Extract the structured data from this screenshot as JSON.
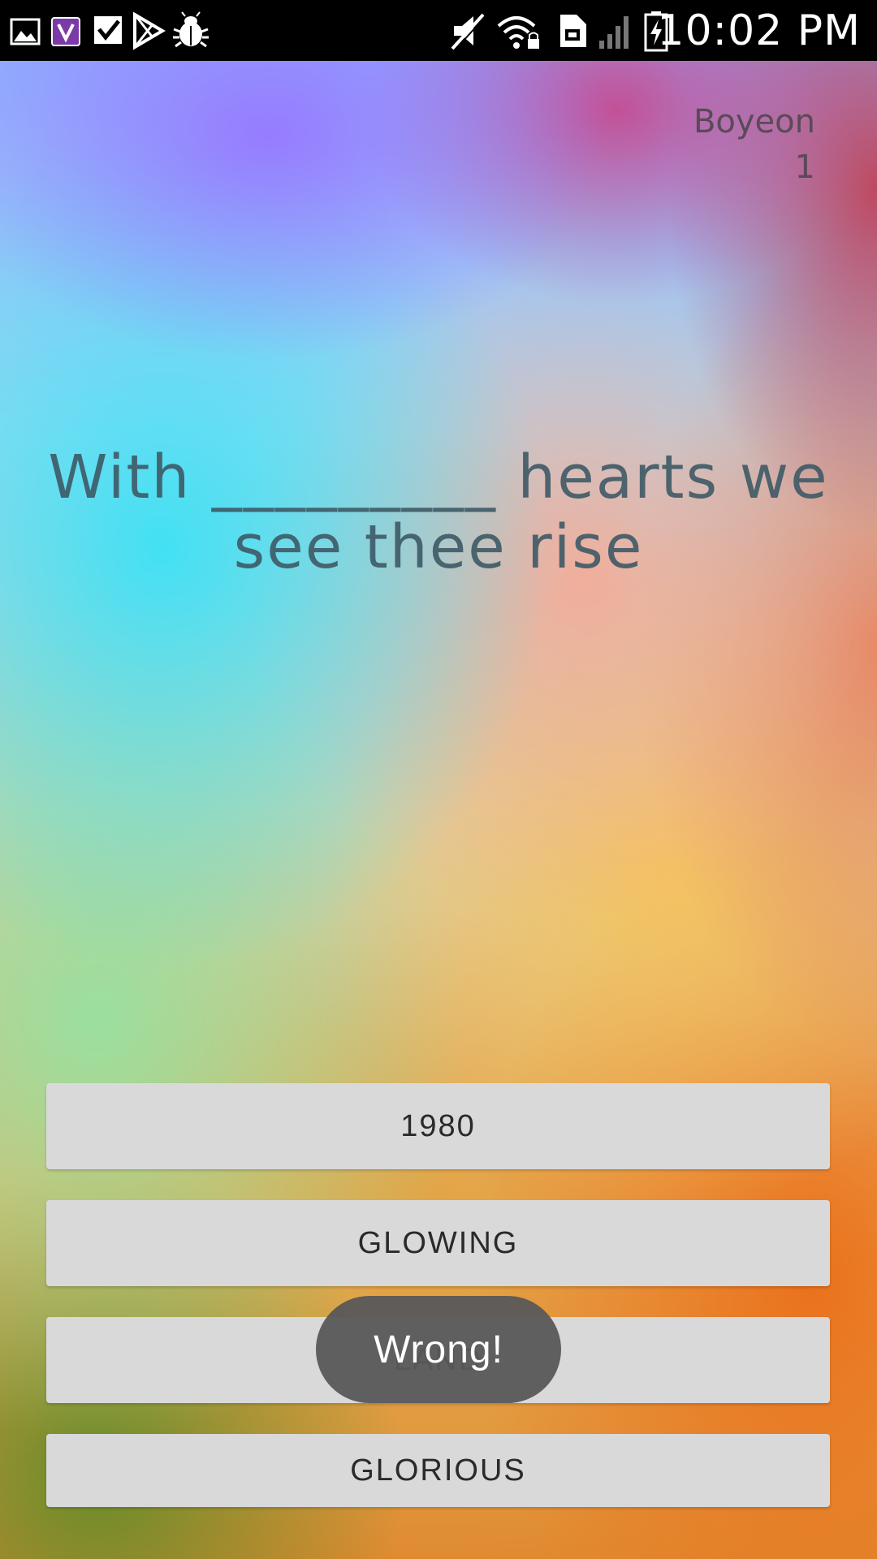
{
  "status_bar": {
    "time": "10:02 PM",
    "left_icons": [
      "gallery-icon",
      "viber-icon",
      "tasks-check-icon",
      "play-store-icon",
      "bug-debug-icon"
    ],
    "right_icons": [
      "mute-icon",
      "wifi-lock-icon",
      "sim-card-icon",
      "signal-icon",
      "battery-charging-icon"
    ]
  },
  "player": {
    "name": "Boyeon",
    "score": "1"
  },
  "question": {
    "text": "With _________ hearts we see thee rise"
  },
  "answers": [
    {
      "label": "1980"
    },
    {
      "label": "GLOWING"
    },
    {
      "label": "LAND"
    },
    {
      "label": "GLORIOUS"
    }
  ],
  "toast": {
    "message": "Wrong!"
  },
  "colors": {
    "button_bg": "#d9d9d9",
    "toast_bg": "#585858",
    "status_bar_bg": "#000000"
  }
}
